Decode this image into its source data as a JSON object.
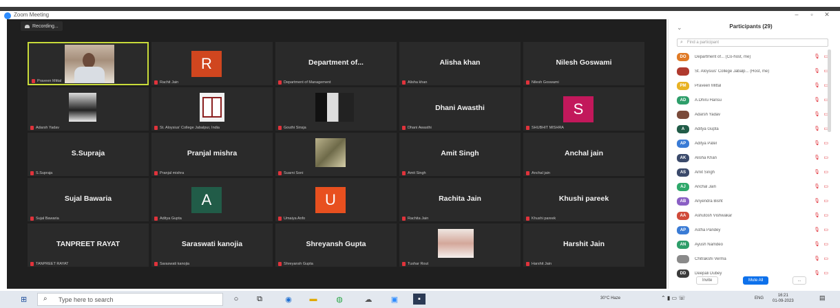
{
  "window": {
    "title": "Zoom Meeting"
  },
  "recording": {
    "label": "Recording..."
  },
  "gallery": {
    "tiles": [
      {
        "name": "",
        "label": "Praveen Mittal",
        "type": "video",
        "active": true
      },
      {
        "name": "",
        "label": "Rachit Jain",
        "type": "avatar",
        "letter": "R",
        "color": "#d0461f"
      },
      {
        "name": "Department of...",
        "label": "Department of Management",
        "type": "name"
      },
      {
        "name": "Alisha khan",
        "label": "Alisha khan",
        "type": "name"
      },
      {
        "name": "Nilesh Goswami",
        "label": "Nilesh Goswami",
        "type": "name"
      },
      {
        "name": "",
        "label": "Adarsh Yadav",
        "type": "photo"
      },
      {
        "name": "",
        "label": "St. Aloysius' College Jabalpur, India",
        "type": "crest"
      },
      {
        "name": "",
        "label": "Gouthi Sinsja",
        "type": "photo"
      },
      {
        "name": "Dhani Awasthi",
        "label": "Dhani Awasthi",
        "type": "name"
      },
      {
        "name": "",
        "label": "SHUBHIT MISHRA",
        "type": "avatar",
        "letter": "S",
        "color": "#c2185b"
      },
      {
        "name": "S.Supraja",
        "label": "S.Supraja",
        "type": "name"
      },
      {
        "name": "Pranjal mishra",
        "label": "Pranjal mishra",
        "type": "name"
      },
      {
        "name": "",
        "label": "Suarni Soni",
        "type": "photo"
      },
      {
        "name": "Amit Singh",
        "label": "Amit Singh",
        "type": "name"
      },
      {
        "name": "Anchal jain",
        "label": "Anchal jain",
        "type": "name"
      },
      {
        "name": "Sujal Bawaria",
        "label": "Sujal Bawaria",
        "type": "name"
      },
      {
        "name": "",
        "label": "Aditya Gupta",
        "type": "avatar",
        "letter": "A",
        "color": "#215c48"
      },
      {
        "name": "",
        "label": "Umaiya Anfo",
        "type": "avatar",
        "letter": "U",
        "color": "#e8501f"
      },
      {
        "name": "Rachita Jain",
        "label": "Rachita Jain",
        "type": "name"
      },
      {
        "name": "Khushi pareek",
        "label": "Khushi pareek",
        "type": "name"
      },
      {
        "name": "TANPREET RAYAT",
        "label": "TANPREET RAYAT",
        "type": "name"
      },
      {
        "name": "Saraswati kanojia",
        "label": "Saraswati kanojia",
        "type": "name"
      },
      {
        "name": "Shreyansh Gupta",
        "label": "Shreyansh Gupta",
        "type": "name"
      },
      {
        "name": "",
        "label": "Tushar Rout",
        "type": "photo"
      },
      {
        "name": "Harshit Jain",
        "label": "Harshit Jain",
        "type": "name"
      }
    ]
  },
  "panel": {
    "title": "Participants (29)",
    "search_placeholder": "Find a participant",
    "participants": [
      {
        "initials": "DO",
        "color": "#e07a26",
        "name": "Department of... (Co-host, me)"
      },
      {
        "initials": "",
        "color": "#b03a2e",
        "name": "St. Aloysius' College Jabalp... (Host, me)"
      },
      {
        "initials": "PM",
        "color": "#e8b224",
        "name": "Praveen Mittal"
      },
      {
        "initials": "AD",
        "color": "#2e9e6a",
        "name": "A.Dhiru Hansu"
      },
      {
        "initials": "",
        "color": "#7a4a3a",
        "name": "Adarsh Yadav"
      },
      {
        "initials": "A",
        "color": "#215c48",
        "name": "Aditya Gupta"
      },
      {
        "initials": "AP",
        "color": "#3a7bd5",
        "name": "Aditya Patel"
      },
      {
        "initials": "AK",
        "color": "#3b4a6b",
        "name": "Alisha Khan"
      },
      {
        "initials": "AS",
        "color": "#3b4a6b",
        "name": "Amit Singh"
      },
      {
        "initials": "AJ",
        "color": "#2ea86a",
        "name": "Anchal Jain"
      },
      {
        "initials": "AB",
        "color": "#8a5fc4",
        "name": "Anyendra Bisht"
      },
      {
        "initials": "AA",
        "color": "#d04a3a",
        "name": "Ashutosh Vishwakar"
      },
      {
        "initials": "AP",
        "color": "#3a7bd5",
        "name": "Astha Pandey"
      },
      {
        "initials": "AN",
        "color": "#2e9e6a",
        "name": "Ayush Namdeo"
      },
      {
        "initials": "",
        "color": "#8a8a8a",
        "name": "Chitrakshi Verma"
      },
      {
        "initials": "DD",
        "color": "#3b3b3b",
        "name": "Deepali Dubey"
      }
    ],
    "invite_label": "Invite",
    "muteall_label": "Mute All",
    "more_label": "..."
  },
  "taskbar": {
    "search_placeholder": "Type here to search",
    "weather": "30°C Haze",
    "lang": "ENG",
    "time": "16:21",
    "date": "01-09-2023"
  }
}
